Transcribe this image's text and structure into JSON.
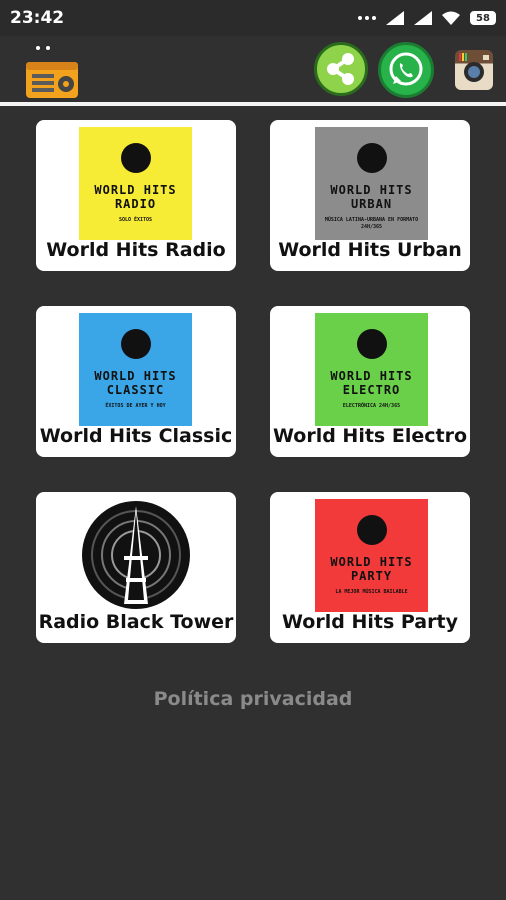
{
  "status": {
    "time": "23:42",
    "battery": "58"
  },
  "toolbar": {
    "app_icon": "radio-icon",
    "share_icon": "share-icon",
    "whatsapp_icon": "whatsapp-icon",
    "instagram_icon": "instagram-icon"
  },
  "stations": [
    {
      "title": "World Hits Radio",
      "cover_line1": "WORLD HITS",
      "cover_line2": "RADIO",
      "cover_sub": "SOLO ÉXITOS",
      "color": "#f6ec36"
    },
    {
      "title": "World Hits Urban",
      "cover_line1": "WORLD HITS",
      "cover_line2": "URBAN",
      "cover_sub": "MÚSICA LATINA-URBANA EN FORMATO 24H/365",
      "color": "#8c8c8c"
    },
    {
      "title": "World Hits Classic",
      "cover_line1": "WORLD HITS",
      "cover_line2": "CLASSIC",
      "cover_sub": "ÉXITOS DE AYER Y HOY",
      "color": "#3aa6e8"
    },
    {
      "title": "World Hits Electro",
      "cover_line1": "WORLD HITS",
      "cover_line2": "ELECTRO",
      "cover_sub": "ELECTRÓNICA 24H/365",
      "color": "#6ad04a"
    },
    {
      "title": "Radio Black Tower",
      "cover_line1": "",
      "cover_line2": "",
      "cover_sub": "",
      "color": "#ffffff"
    },
    {
      "title": "World Hits Party",
      "cover_line1": "WORLD HITS",
      "cover_line2": "PARTY",
      "cover_sub": "LA MEJOR MÚSICA BAILABLE",
      "color": "#f23a3a"
    }
  ],
  "privacy": "Política privacidad"
}
